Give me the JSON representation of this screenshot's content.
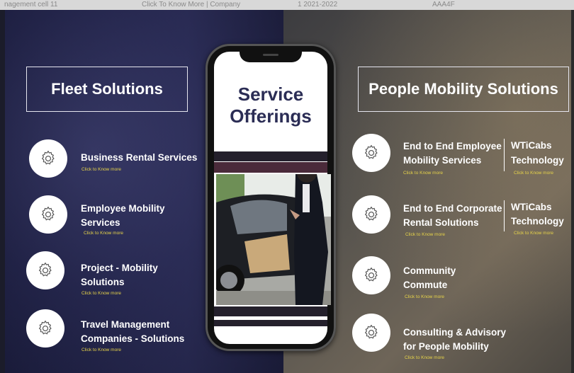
{
  "top_strip": [
    "nagement cell 11",
    "Click To Know More | Company",
    "1 2021-2022",
    "AAA4F"
  ],
  "fleet": {
    "title": "Fleet Solutions",
    "items": [
      {
        "label1": "Business Rental Services",
        "label2": "",
        "know": "Click to Know more"
      },
      {
        "label1": "Employee Mobility",
        "label2": "Services",
        "know": "Click to Know more"
      },
      {
        "label1": "Project - Mobility",
        "label2": "Solutions",
        "know": "Click to Know more"
      },
      {
        "label1": "Travel Management",
        "label2": "Companies - Solutions",
        "know": "Click to Know more"
      }
    ]
  },
  "center": {
    "title_line1": "Service",
    "title_line2": "Offerings"
  },
  "people": {
    "title": "People Mobility Solutions",
    "items": [
      {
        "label1": "End to End Employee",
        "label2": "Mobility Services",
        "know": "Click to Know more",
        "side1": "WTiCabs",
        "side2": "Technology",
        "side_know": "Click to Know more"
      },
      {
        "label1": "End to End Corporate",
        "label2": "Rental Solutions",
        "know": "Click to Know more",
        "side1": "WTiCabs",
        "side2": "Technology",
        "side_know": "Click to Know more"
      },
      {
        "label1": "Community",
        "label2": "Commute",
        "know": "Click to Know more"
      },
      {
        "label1": "Consulting & Advisory",
        "label2": "for People Mobility",
        "know": "Click to Know more"
      }
    ]
  },
  "icon": "gear-icon",
  "colors": {
    "accent_yellow": "#e6d34a",
    "title_navy": "#2b2d55",
    "left_bg": "#25274e"
  }
}
